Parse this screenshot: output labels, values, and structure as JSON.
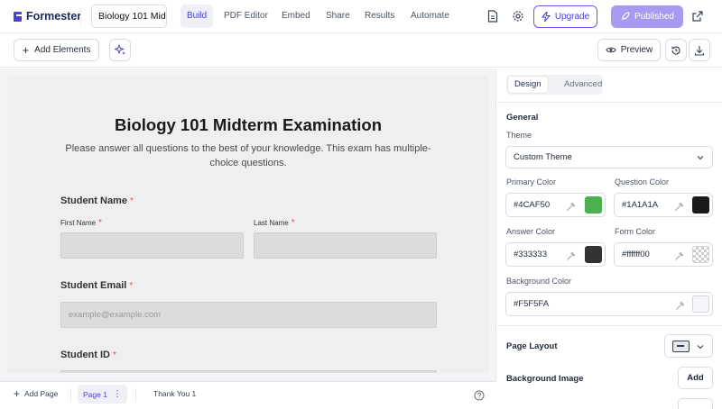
{
  "app": {
    "name": "Formester"
  },
  "header": {
    "form_title": "Biology 101 Midterm Examination",
    "tabs": [
      {
        "label": "Build",
        "active": true
      },
      {
        "label": "PDF Editor",
        "active": false
      },
      {
        "label": "Embed",
        "active": false
      },
      {
        "label": "Share",
        "active": false
      },
      {
        "label": "Results",
        "active": false
      },
      {
        "label": "Automate",
        "active": false
      }
    ],
    "upgrade_label": "Upgrade",
    "published_label": "Published"
  },
  "toolbar": {
    "add_elements_label": "Add Elements",
    "preview_label": "Preview"
  },
  "form": {
    "title": "Biology 101 Midterm Examination",
    "description": "Please answer all questions to the best of your knowledge. This exam has multiple-choice questions.",
    "questions": {
      "student_name": {
        "label": "Student Name",
        "required_mark": "*",
        "first_name_label": "First Name",
        "last_name_label": "Last Name"
      },
      "student_email": {
        "label": "Student Email",
        "required_mark": "*",
        "placeholder": "example@example.com"
      },
      "student_id": {
        "label": "Student ID",
        "required_mark": "*"
      }
    }
  },
  "bottom_bar": {
    "add_page_label": "Add Page",
    "pages": [
      "Page 1",
      "Thank You 1"
    ]
  },
  "panel": {
    "tabs": [
      {
        "label": "Design",
        "active": true
      },
      {
        "label": "Advanced",
        "active": false
      }
    ],
    "general": {
      "title": "General",
      "theme_label": "Theme",
      "theme_value": "Custom Theme",
      "primary_color": {
        "label": "Primary Color",
        "value": "#4CAF50",
        "swatch": "#4CAF50"
      },
      "question_color": {
        "label": "Question Color",
        "value": "#1A1A1A",
        "swatch": "#1A1A1A"
      },
      "answer_color": {
        "label": "Answer Color",
        "value": "#333333",
        "swatch": "#333333"
      },
      "form_color": {
        "label": "Form Color",
        "value": "#ffffff00",
        "swatch": "transparent"
      },
      "background_color": {
        "label": "Background Color",
        "value": "#F5F5FA",
        "swatch": "#F5F5FA"
      }
    },
    "page_layout_label": "Page Layout",
    "background_image_label": "Background Image",
    "background_image_button": "Add"
  },
  "colors": {
    "brand": "#4a3fd6",
    "published_bg": "#a89af0",
    "required": "#e05252"
  }
}
